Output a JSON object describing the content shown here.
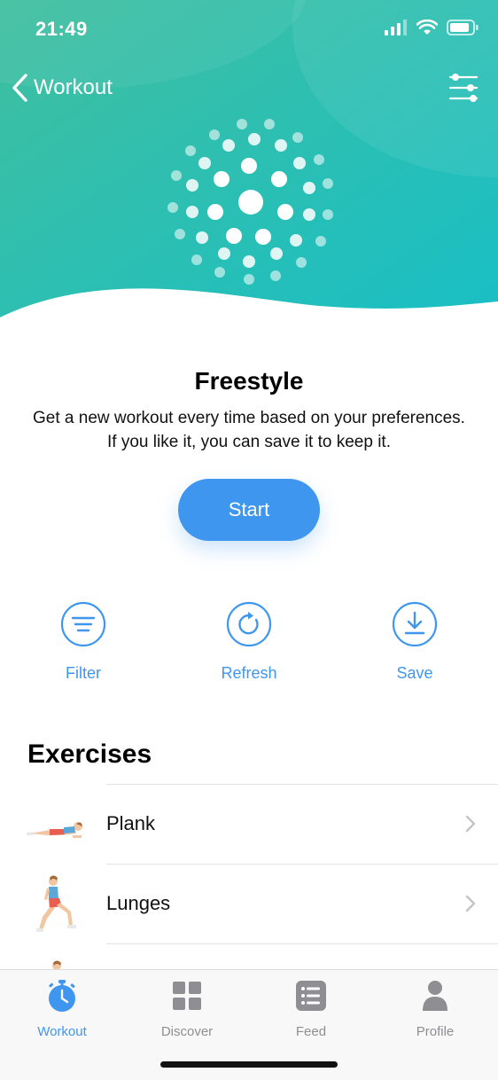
{
  "status_bar": {
    "time": "21:49"
  },
  "nav": {
    "back_label": "Workout"
  },
  "hero": {
    "gradient_start": "#3dbfa8",
    "gradient_end": "#1cc0c4",
    "dot_color": "#ffffff"
  },
  "workout": {
    "title": "Freestyle",
    "description": "Get a new workout every time based on your preferences. If you like it, you can save it to keep it.",
    "start_label": "Start"
  },
  "actions": [
    {
      "label": "Filter",
      "icon": "filter-icon"
    },
    {
      "label": "Refresh",
      "icon": "refresh-icon"
    },
    {
      "label": "Save",
      "icon": "download-icon"
    }
  ],
  "exercises": {
    "section_title": "Exercises",
    "items": [
      {
        "name": "Plank",
        "icon": "plank-figure"
      },
      {
        "name": "Lunges",
        "icon": "lunges-figure"
      }
    ]
  },
  "tabbar": {
    "items": [
      {
        "label": "Workout",
        "icon": "stopwatch-icon",
        "active": true
      },
      {
        "label": "Discover",
        "icon": "grid-icon",
        "active": false
      },
      {
        "label": "Feed",
        "icon": "list-icon",
        "active": false
      },
      {
        "label": "Profile",
        "icon": "person-icon",
        "active": false
      }
    ]
  },
  "colors": {
    "accent": "#3f96ee",
    "inactive": "#8e8e93"
  }
}
